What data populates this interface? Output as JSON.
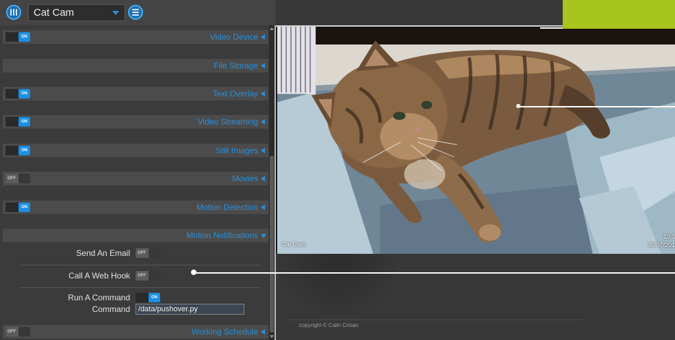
{
  "header": {
    "camera_select": {
      "value": "Cat Cam"
    }
  },
  "icons": {
    "menu": "menu-icon",
    "layers": "layers-icon",
    "dropdown": "chevron-down-icon",
    "section_collapsed": "arrow-left-icon",
    "section_expanded": "arrow-down-icon"
  },
  "settings": {
    "sections": [
      {
        "title": "Video Device",
        "toggle": "ON"
      },
      {
        "title": "File Storage"
      },
      {
        "title": "Text Overlay",
        "toggle": "ON"
      },
      {
        "title": "Video Streaming",
        "toggle": "ON"
      },
      {
        "title": "Still Images",
        "toggle": "ON"
      },
      {
        "title": "Movies",
        "toggle": "OFF"
      },
      {
        "title": "Motion Detection",
        "toggle": "ON"
      },
      {
        "title": "Motion Notifications",
        "expanded": true,
        "items": [
          {
            "label": "Send An Email",
            "toggle": "OFF"
          },
          {
            "label": "Call A Web Hook",
            "toggle": "OFF"
          },
          {
            "label": "Run A Command",
            "toggle": "ON"
          },
          {
            "label": "Command",
            "value": "/data/pushover.py"
          }
        ]
      },
      {
        "title": "Working Schedule",
        "toggle": "OFF"
      }
    ]
  },
  "camera": {
    "name_overlay": "Cat Cam",
    "time_overlay": "10:3",
    "date_overlay": "30/07/201"
  },
  "footer": {
    "copyright": "copyright © Calin Crisan"
  },
  "colors": {
    "accent": "#2b8fd6",
    "toggle_on": "#1c8fe3",
    "highlight_box": "#a7c51c"
  }
}
